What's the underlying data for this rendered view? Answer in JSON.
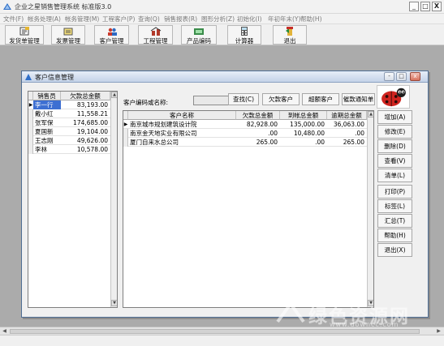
{
  "window": {
    "title": "企业之星销售管理系统  标准版3.0",
    "minimize_glyph": "_",
    "maximize_glyph": "□",
    "close_glyph": "X"
  },
  "menu": [
    "文件(F)",
    "帐务处理(A)",
    "帐务管理(M)",
    "工程客户(P)",
    "查询(Q)",
    "销售报表(R)",
    "图形分析(Z)",
    "初始化(I)",
    "年初年末(Y)",
    "帮助(H)"
  ],
  "toolbar": [
    {
      "label": "发货单管理",
      "icon": "invoice-icon"
    },
    {
      "label": "发票管理",
      "icon": "receipt-icon"
    },
    {
      "label": "客户管理",
      "icon": "customer-icon"
    },
    {
      "label": "工程管理",
      "icon": "project-icon"
    },
    {
      "label": "产品编码",
      "icon": "product-code-icon"
    },
    {
      "label": "计算器",
      "icon": "calculator-icon"
    },
    {
      "label": "退出",
      "icon": "exit-icon"
    }
  ],
  "dialog": {
    "title": "客户信息管理",
    "min_glyph": "-",
    "max_glyph": "□",
    "close_glyph": "x",
    "salespeople": {
      "headers": [
        "销售员",
        "欠款总金额"
      ],
      "rows": [
        {
          "name": "李一行",
          "amount": "83,193.00"
        },
        {
          "name": "戴小红",
          "amount": "11,558.21"
        },
        {
          "name": "张军保",
          "amount": "174,685.00"
        },
        {
          "name": "夏国新",
          "amount": "19,104.00"
        },
        {
          "name": "王志刚",
          "amount": "49,626.00"
        },
        {
          "name": "李林",
          "amount": "10,578.00"
        }
      ]
    },
    "search": {
      "label": "客户编码或名称:",
      "value": ""
    },
    "filters": [
      "查找(C)",
      "欠款客户",
      "超额客户",
      "催款通知单"
    ],
    "customers": {
      "headers": [
        "客户名称",
        "欠款总金额",
        "到帐总金额",
        "逾期总金额"
      ],
      "rows": [
        {
          "name": "南京城市规划建筑设计院",
          "debt": "82,928.00",
          "received": "135,000.00",
          "overdue": "36,063.00"
        },
        {
          "name": "南京金天地实业有限公司",
          "debt": ".00",
          "received": "10,480.00",
          "overdue": ".00"
        },
        {
          "name": "厦门自来水总公司",
          "debt": "265.00",
          "received": ".00",
          "overdue": "265.00"
        }
      ]
    },
    "actions": [
      "增加(A)",
      "修改(E)",
      "删除(D)",
      "查看(V)",
      "清单(L)",
      "打印(P)",
      "标签(L)",
      "汇总(T)",
      "帮助(H)",
      "退出(X)"
    ]
  },
  "watermark": {
    "text": "绿色资源网",
    "sub": "www.downcc.com"
  }
}
